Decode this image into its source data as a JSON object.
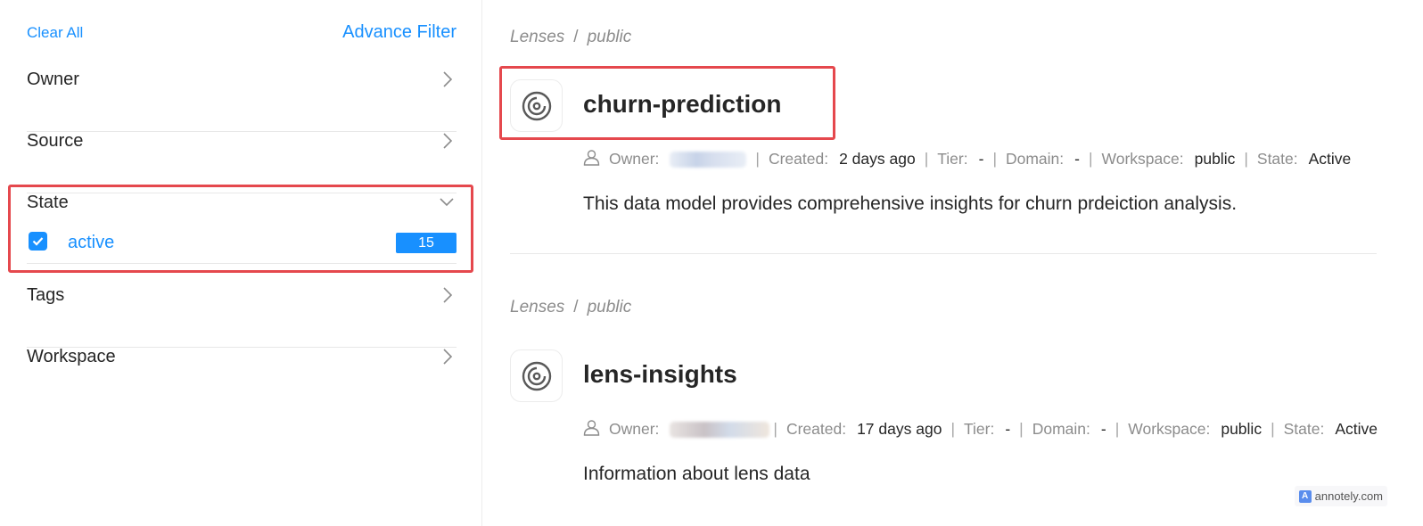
{
  "sidebar": {
    "clear_all": "Clear All",
    "advance_filter": "Advance Filter",
    "filters": [
      {
        "label": "Owner"
      },
      {
        "label": "Source"
      },
      {
        "label": "State",
        "expanded": true,
        "options": [
          {
            "label": "active",
            "checked": true,
            "count": "15"
          }
        ]
      },
      {
        "label": "Tags"
      },
      {
        "label": "Workspace"
      }
    ]
  },
  "results": [
    {
      "breadcrumb": [
        "Lenses",
        "public"
      ],
      "title": "churn-prediction",
      "icon": "lens-icon",
      "meta": {
        "owner_label": "Owner:",
        "created_label": "Created:",
        "created": "2 days ago",
        "tier_label": "Tier:",
        "tier": "-",
        "domain_label": "Domain:",
        "domain": "-",
        "workspace_label": "Workspace:",
        "workspace": "public",
        "state_label": "State:",
        "state": "Active"
      },
      "description": "This data model provides comprehensive insights for churn prdeiction analysis."
    },
    {
      "breadcrumb": [
        "Lenses",
        "public"
      ],
      "title": "lens-insights",
      "icon": "lens-icon",
      "meta": {
        "owner_label": "Owner:",
        "created_label": "Created:",
        "created": "17 days ago",
        "tier_label": "Tier:",
        "tier": "-",
        "domain_label": "Domain:",
        "domain": "-",
        "workspace_label": "Workspace:",
        "workspace": "public",
        "state_label": "State:",
        "state": "Active"
      },
      "description": "Information about lens data"
    }
  ],
  "watermark": "annotely.com",
  "colors": {
    "accent": "#1890ff",
    "highlight": "#e5484d",
    "text": "#262626",
    "muted": "#8c8c8c"
  }
}
